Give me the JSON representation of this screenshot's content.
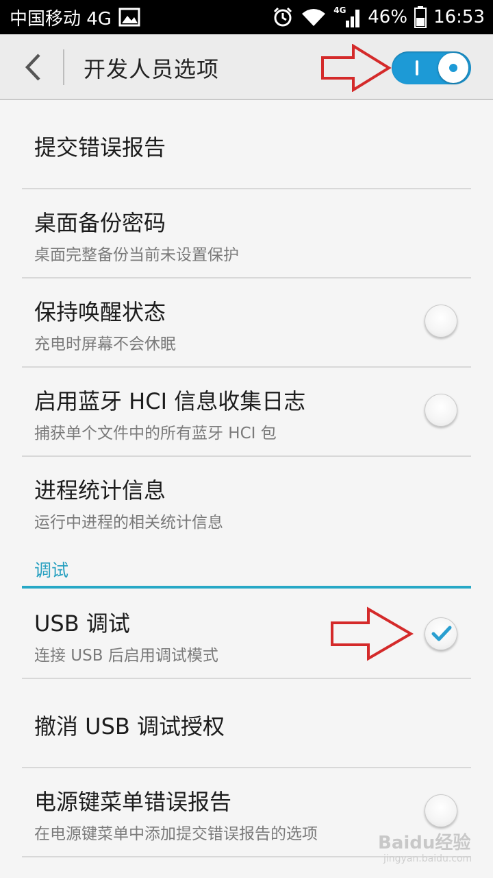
{
  "status_bar": {
    "carrier": "中国移动 4G",
    "network_label": "4G",
    "battery": "46%",
    "time": "16:53"
  },
  "action_bar": {
    "title": "开发人员选项",
    "master_switch_on": true
  },
  "items": [
    {
      "title": "提交错误报告",
      "subtitle": "",
      "control": "none"
    },
    {
      "title": "桌面备份密码",
      "subtitle": "桌面完整备份当前未设置保护",
      "control": "none"
    },
    {
      "title": "保持唤醒状态",
      "subtitle": "充电时屏幕不会休眠",
      "control": "radio",
      "checked": false
    },
    {
      "title": "启用蓝牙 HCI 信息收集日志",
      "subtitle": "捕获单个文件中的所有蓝牙 HCI 包",
      "control": "radio",
      "checked": false
    },
    {
      "title": "进程统计信息",
      "subtitle": "运行中进程的相关统计信息",
      "control": "none"
    }
  ],
  "section": {
    "label": "调试"
  },
  "debug_items": [
    {
      "title": "USB 调试",
      "subtitle": "连接 USB 后启用调试模式",
      "control": "radio",
      "checked": true
    },
    {
      "title": "撤消 USB 调试授权",
      "subtitle": "",
      "control": "none"
    },
    {
      "title": "电源键菜单错误报告",
      "subtitle": "在电源键菜单中添加提交错误报告的选项",
      "control": "radio",
      "checked": false
    }
  ],
  "colors": {
    "accent": "#1d9ad6",
    "section": "#27a8c6",
    "annotation": "#d42a2a"
  },
  "watermark": {
    "text": "Baidu经验",
    "sub": "jingyan.baidu.com"
  }
}
